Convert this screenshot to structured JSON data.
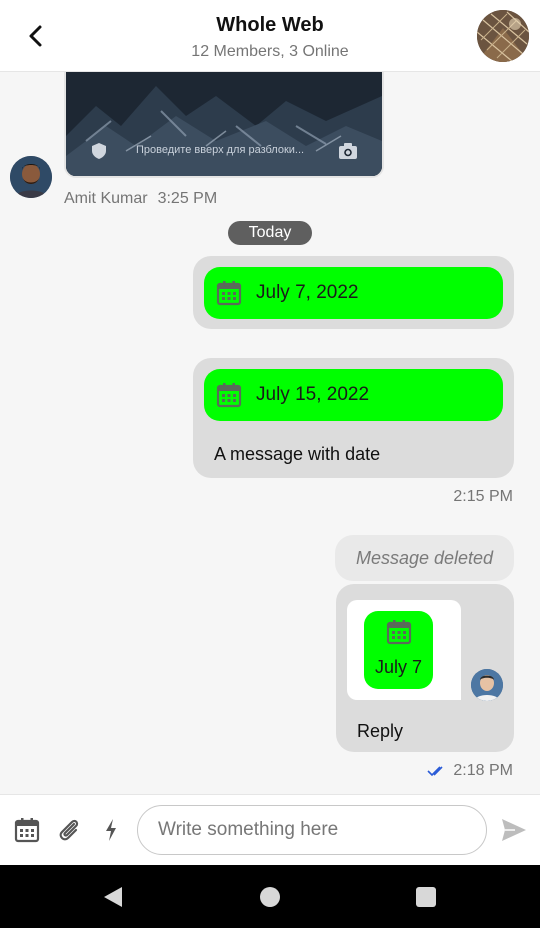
{
  "header": {
    "title": "Whole Web",
    "subtitle": "12 Members, 3 Online"
  },
  "feed": {
    "image_message": {
      "lock_screen_text": "Проведите вверх для разблоки...",
      "sender_name": "Amit Kumar",
      "time": "3:25 PM"
    },
    "date_separator": "Today",
    "date_message_1": {
      "date": "July 7, 2022"
    },
    "date_message_2": {
      "date": "July 15, 2022",
      "text": "A message with date",
      "time": "2:15 PM"
    },
    "deleted_message": {
      "text": "Message deleted"
    },
    "reply_message": {
      "quoted_date": "July 7",
      "text": "Reply",
      "time": "2:18 PM",
      "status": "read"
    }
  },
  "composer": {
    "placeholder": "Write something here",
    "value": ""
  },
  "colors": {
    "date_chip": "#00ff00",
    "bubble": "#dcdcdc",
    "read_ticks": "#2a5bd7",
    "separator_pill": "#5f5f5f"
  }
}
